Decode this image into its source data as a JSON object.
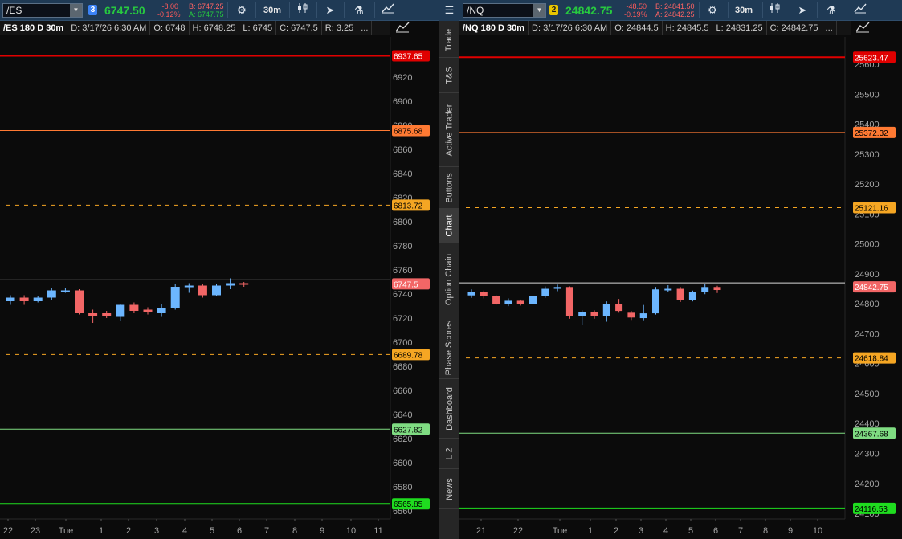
{
  "colors": {
    "up": "#6cb6ff",
    "down": "#f26666",
    "red": "#e00000",
    "orange": "#ff7a33",
    "amber": "#f5a623",
    "white": "#d8d8d8",
    "green_light": "#7fdc82",
    "green": "#1fdc1f",
    "price_up": "#27c93f"
  },
  "side_tabs": [
    "Trade",
    "T&S",
    "Active Trader",
    "Buttons",
    "Chart",
    "Option Chain",
    "Phase Scores",
    "Dashboard",
    "L 2",
    "News"
  ],
  "side_menu_icon": "menu-lines-icon",
  "panels": [
    {
      "symbol": "/ES",
      "link_number": "3",
      "link_color": "#3b82f6",
      "last": "6747.50",
      "change": "-8.00",
      "change_pct": "-0.12%",
      "bid": "B: 6747.25",
      "ask": "A: 6747.75",
      "timeframe": "30m",
      "info": {
        "title": "/ES 180 D 30m",
        "date": "D: 3/17/26 6:30 AM",
        "open": "O: 6748",
        "high": "H: 6748.25",
        "low": "L: 6745",
        "close": "C: 6747.5",
        "range": "R: 3.25",
        "more": "..."
      },
      "axis": {
        "ticks": [
          "6920",
          "6900",
          "6880",
          "6860",
          "6840",
          "6820",
          "6800",
          "6780",
          "6760",
          "6740",
          "6720",
          "6700",
          "6680",
          "6660",
          "6640",
          "6620",
          "6600",
          "6580",
          "6560"
        ],
        "ymin": 6553,
        "ymax": 6955
      },
      "levels": [
        {
          "value": 6937.65,
          "label": "6937.65",
          "color": "red",
          "style": "solid"
        },
        {
          "value": 6875.68,
          "label": "6875.68",
          "color": "orange",
          "style": "solid"
        },
        {
          "value": 6813.72,
          "label": "6813.72",
          "color": "amber",
          "style": "dashed"
        },
        {
          "value": 6751.75,
          "label": "6747.5",
          "color": "white",
          "style": "solid"
        },
        {
          "value": 6689.78,
          "label": "6689.78",
          "color": "amber",
          "style": "dashed"
        },
        {
          "value": 6627.82,
          "label": "6627.82",
          "color": "green_light",
          "style": "solid"
        },
        {
          "value": 6565.85,
          "label": "6565.85",
          "color": "green",
          "style": "solid"
        }
      ],
      "x_labels": [
        "22",
        "23",
        "Tue",
        "1",
        "2",
        "3",
        "4",
        "5",
        "6",
        "7",
        "8",
        "9",
        "10",
        "11"
      ],
      "candles": [
        {
          "o": 6734,
          "c": 6737,
          "h": 6739,
          "l": 6731
        },
        {
          "o": 6737,
          "c": 6734,
          "h": 6739,
          "l": 6731
        },
        {
          "o": 6734,
          "c": 6737,
          "h": 6738,
          "l": 6733
        },
        {
          "o": 6737,
          "c": 6743,
          "h": 6745,
          "l": 6735
        },
        {
          "o": 6742,
          "c": 6743,
          "h": 6745,
          "l": 6741
        },
        {
          "o": 6743,
          "c": 6724,
          "h": 6744,
          "l": 6723
        },
        {
          "o": 6724,
          "c": 6722,
          "h": 6727,
          "l": 6716
        },
        {
          "o": 6724,
          "c": 6722,
          "h": 6726,
          "l": 6720
        },
        {
          "o": 6721,
          "c": 6731,
          "h": 6732,
          "l": 6718
        },
        {
          "o": 6731,
          "c": 6726,
          "h": 6733,
          "l": 6724
        },
        {
          "o": 6727,
          "c": 6725,
          "h": 6729,
          "l": 6723
        },
        {
          "o": 6724,
          "c": 6728,
          "h": 6732,
          "l": 6721
        },
        {
          "o": 6728,
          "c": 6746,
          "h": 6748,
          "l": 6727
        },
        {
          "o": 6746,
          "c": 6747,
          "h": 6749,
          "l": 6741
        },
        {
          "o": 6747,
          "c": 6739,
          "h": 6748,
          "l": 6737
        },
        {
          "o": 6739,
          "c": 6747,
          "h": 6748,
          "l": 6738
        },
        {
          "o": 6747,
          "c": 6749,
          "h": 6753,
          "l": 6744
        },
        {
          "o": 6749,
          "c": 6748,
          "h": 6750,
          "l": 6746
        }
      ]
    },
    {
      "symbol": "/NQ",
      "link_number": "2",
      "link_color": "#e6c400",
      "last": "24842.75",
      "change": "-48.50",
      "change_pct": "-0.19%",
      "bid": "B: 24841.50",
      "ask": "A: 24842.25",
      "timeframe": "30m",
      "info": {
        "title": "/NQ 180 D 30m",
        "date": "D: 3/17/26 6:30 AM",
        "open": "O: 24844.5",
        "high": "H: 24845.5",
        "low": "L: 24831.25",
        "close": "C: 24842.75",
        "more": "..."
      },
      "axis": {
        "ticks": [
          "25600",
          "25500",
          "25400",
          "25300",
          "25200",
          "25100",
          "25000",
          "24900",
          "24800",
          "24700",
          "24600",
          "24500",
          "24400",
          "24300",
          "24200",
          "24100"
        ],
        "ymin": 24090,
        "ymax": 25665
      },
      "levels": [
        {
          "value": 25623.47,
          "label": "25623.47",
          "color": "red",
          "style": "solid"
        },
        {
          "value": 25372.32,
          "label": "25372.32",
          "color": "orange",
          "style": "solid"
        },
        {
          "value": 25121.16,
          "label": "25121.16",
          "color": "amber",
          "style": "dashed"
        },
        {
          "value": 24870.0,
          "label": "24842.75",
          "color": "white",
          "style": "solid"
        },
        {
          "value": 24618.84,
          "label": "24618.84",
          "color": "amber",
          "style": "dashed"
        },
        {
          "value": 24367.68,
          "label": "24367.68",
          "color": "green_light",
          "style": "solid"
        },
        {
          "value": 24116.53,
          "label": "24116.53",
          "color": "green",
          "style": "solid"
        }
      ],
      "x_labels": [
        "21",
        "22",
        "Tue",
        "1",
        "2",
        "3",
        "4",
        "5",
        "6",
        "7",
        "8",
        "9",
        "10"
      ],
      "candles": [
        {
          "o": 24828,
          "c": 24840,
          "h": 24848,
          "l": 24820
        },
        {
          "o": 24840,
          "c": 24826,
          "h": 24844,
          "l": 24818
        },
        {
          "o": 24826,
          "c": 24800,
          "h": 24830,
          "l": 24796
        },
        {
          "o": 24800,
          "c": 24810,
          "h": 24818,
          "l": 24792
        },
        {
          "o": 24810,
          "c": 24800,
          "h": 24814,
          "l": 24794
        },
        {
          "o": 24800,
          "c": 24826,
          "h": 24832,
          "l": 24798
        },
        {
          "o": 24826,
          "c": 24850,
          "h": 24858,
          "l": 24820
        },
        {
          "o": 24850,
          "c": 24856,
          "h": 24864,
          "l": 24842
        },
        {
          "o": 24856,
          "c": 24760,
          "h": 24858,
          "l": 24750
        },
        {
          "o": 24760,
          "c": 24772,
          "h": 24778,
          "l": 24730
        },
        {
          "o": 24772,
          "c": 24758,
          "h": 24778,
          "l": 24750
        },
        {
          "o": 24758,
          "c": 24798,
          "h": 24808,
          "l": 24740
        },
        {
          "o": 24798,
          "c": 24776,
          "h": 24816,
          "l": 24770
        },
        {
          "o": 24770,
          "c": 24754,
          "h": 24776,
          "l": 24746
        },
        {
          "o": 24752,
          "c": 24768,
          "h": 24796,
          "l": 24745
        },
        {
          "o": 24768,
          "c": 24848,
          "h": 24856,
          "l": 24764
        },
        {
          "o": 24846,
          "c": 24850,
          "h": 24862,
          "l": 24840
        },
        {
          "o": 24850,
          "c": 24812,
          "h": 24856,
          "l": 24806
        },
        {
          "o": 24812,
          "c": 24838,
          "h": 24844,
          "l": 24808
        },
        {
          "o": 24838,
          "c": 24856,
          "h": 24866,
          "l": 24832
        },
        {
          "o": 24856,
          "c": 24846,
          "h": 24860,
          "l": 24836
        }
      ]
    }
  ]
}
